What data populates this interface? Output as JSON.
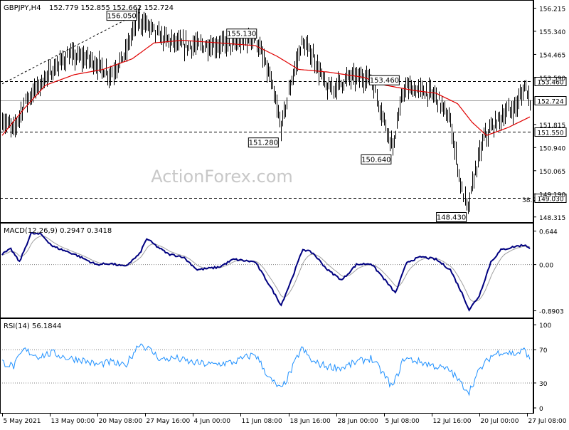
{
  "header": {
    "symbol_label": "GBPJPY,H4",
    "ohlc_label": "152.779 152.855 152.662 152.724",
    "macd_label": "MACD(12,26,9) 0.2947 0.3418",
    "rsi_label": "RSI(14) 56.1844",
    "watermark": "ActionForex.com"
  },
  "colors": {
    "price_bars": "#000000",
    "moving_average": "#e00000",
    "macd_line": "#000080",
    "macd_signal": "#a0a0a0",
    "rsi_line": "#1e90ff",
    "levels": "#000000",
    "frame": "#000000"
  },
  "chart_data": [
    {
      "type": "candlestick",
      "panel": "price",
      "title": "GBPJPY,H4",
      "x_tick_labels": [
        "5 May 2021",
        "13 May 00:00",
        "20 May 08:00",
        "27 May 16:00",
        "4 Jun 00:00",
        "11 Jun 08:00",
        "18 Jun 16:00",
        "28 Jun 00:00",
        "5 Jul 08:00",
        "12 Jul 16:00",
        "20 Jul 00:00",
        "27 Jul 08:00"
      ],
      "y_tick_labels": [
        "156.215",
        "155.340",
        "154.465",
        "153.590",
        "152.724",
        "151.815",
        "150.940",
        "150.065",
        "149.190",
        "148.315"
      ],
      "ylim": [
        148.12,
        156.47
      ],
      "anchor_points": [
        {
          "i": 0,
          "price": 152.0
        },
        {
          "i": 8,
          "price": 151.6
        },
        {
          "i": 16,
          "price": 152.7
        },
        {
          "i": 30,
          "price": 153.6
        },
        {
          "i": 45,
          "price": 154.4
        },
        {
          "i": 60,
          "price": 154.3
        },
        {
          "i": 75,
          "price": 153.7
        },
        {
          "i": 85,
          "price": 154.5
        },
        {
          "i": 93,
          "price": 155.8
        },
        {
          "i": 100,
          "price": 155.6
        },
        {
          "i": 110,
          "price": 155.1
        },
        {
          "i": 125,
          "price": 154.8
        },
        {
          "i": 145,
          "price": 154.8
        },
        {
          "i": 165,
          "price": 154.9
        },
        {
          "i": 175,
          "price": 155.1
        },
        {
          "i": 185,
          "price": 153.6
        },
        {
          "i": 193,
          "price": 151.7
        },
        {
          "i": 200,
          "price": 153.5
        },
        {
          "i": 207,
          "price": 154.9
        },
        {
          "i": 215,
          "price": 154.4
        },
        {
          "i": 225,
          "price": 153.1
        },
        {
          "i": 240,
          "price": 153.6
        },
        {
          "i": 255,
          "price": 153.6
        },
        {
          "i": 262,
          "price": 152.3
        },
        {
          "i": 270,
          "price": 151.0
        },
        {
          "i": 278,
          "price": 153.2
        },
        {
          "i": 290,
          "price": 153.1
        },
        {
          "i": 300,
          "price": 152.9
        },
        {
          "i": 310,
          "price": 151.9
        },
        {
          "i": 318,
          "price": 149.3
        },
        {
          "i": 322,
          "price": 148.6
        },
        {
          "i": 326,
          "price": 149.8
        },
        {
          "i": 333,
          "price": 151.3
        },
        {
          "i": 345,
          "price": 152.1
        },
        {
          "i": 355,
          "price": 152.5
        },
        {
          "i": 362,
          "price": 153.3
        },
        {
          "i": 365,
          "price": 152.7
        }
      ],
      "moving_average_points": [
        {
          "i": 0,
          "price": 151.4
        },
        {
          "i": 15,
          "price": 152.4
        },
        {
          "i": 30,
          "price": 153.3
        },
        {
          "i": 50,
          "price": 153.7
        },
        {
          "i": 70,
          "price": 153.9
        },
        {
          "i": 90,
          "price": 154.3
        },
        {
          "i": 105,
          "price": 154.9
        },
        {
          "i": 125,
          "price": 155.0
        },
        {
          "i": 150,
          "price": 154.9
        },
        {
          "i": 175,
          "price": 154.8
        },
        {
          "i": 190,
          "price": 154.4
        },
        {
          "i": 205,
          "price": 153.9
        },
        {
          "i": 225,
          "price": 153.8
        },
        {
          "i": 250,
          "price": 153.6
        },
        {
          "i": 265,
          "price": 153.3
        },
        {
          "i": 285,
          "price": 153.1
        },
        {
          "i": 300,
          "price": 153.0
        },
        {
          "i": 315,
          "price": 152.6
        },
        {
          "i": 325,
          "price": 151.9
        },
        {
          "i": 335,
          "price": 151.4
        },
        {
          "i": 350,
          "price": 151.7
        },
        {
          "i": 365,
          "price": 152.1
        }
      ],
      "levels": [
        {
          "price": 153.46,
          "label": "153.460",
          "style": "dashed"
        },
        {
          "price": 152.724,
          "label": "152.724",
          "style": "solid-gray"
        },
        {
          "price": 151.55,
          "label": "151.550",
          "style": "dashed"
        },
        {
          "price": 149.03,
          "label": "149.030",
          "style": "dashed"
        }
      ],
      "fib_label": "38.2",
      "annotations": [
        {
          "text": "156.050",
          "i": 95,
          "price": 156.05
        },
        {
          "text": "155.130",
          "i": 175,
          "price": 155.13
        },
        {
          "text": "151.280",
          "i": 193,
          "price": 151.28
        },
        {
          "text": "153.460",
          "i": 255,
          "price": 153.46
        },
        {
          "text": "150.640",
          "i": 270,
          "price": 150.64
        },
        {
          "text": "148.430",
          "i": 322,
          "price": 148.43
        }
      ],
      "trendline": [
        {
          "i": 0,
          "price": 153.35
        },
        {
          "i": 95,
          "price": 156.05
        }
      ]
    },
    {
      "type": "line",
      "panel": "macd",
      "title": "MACD(12,26,9) 0.2947 0.3418",
      "y_tick_labels": [
        "0.644",
        "0.00",
        "-0.8903"
      ],
      "ylim": [
        -1.02,
        0.79
      ],
      "anchor_points": [
        {
          "i": 0,
          "value": 0.2
        },
        {
          "i": 6,
          "value": 0.3
        },
        {
          "i": 12,
          "value": 0.05
        },
        {
          "i": 20,
          "value": 0.6
        },
        {
          "i": 27,
          "value": 0.58
        },
        {
          "i": 35,
          "value": 0.35
        },
        {
          "i": 50,
          "value": 0.2
        },
        {
          "i": 65,
          "value": 0.0
        },
        {
          "i": 75,
          "value": 0.02
        },
        {
          "i": 85,
          "value": -0.04
        },
        {
          "i": 95,
          "value": 0.2
        },
        {
          "i": 100,
          "value": 0.5
        },
        {
          "i": 107,
          "value": 0.35
        },
        {
          "i": 115,
          "value": 0.2
        },
        {
          "i": 125,
          "value": 0.15
        },
        {
          "i": 135,
          "value": -0.1
        },
        {
          "i": 150,
          "value": -0.05
        },
        {
          "i": 160,
          "value": 0.1
        },
        {
          "i": 175,
          "value": 0.05
        },
        {
          "i": 185,
          "value": -0.4
        },
        {
          "i": 193,
          "value": -0.78
        },
        {
          "i": 200,
          "value": -0.3
        },
        {
          "i": 208,
          "value": 0.3
        },
        {
          "i": 215,
          "value": 0.22
        },
        {
          "i": 225,
          "value": -0.1
        },
        {
          "i": 235,
          "value": -0.3
        },
        {
          "i": 245,
          "value": 0.0
        },
        {
          "i": 255,
          "value": 0.02
        },
        {
          "i": 262,
          "value": -0.2
        },
        {
          "i": 272,
          "value": -0.55
        },
        {
          "i": 280,
          "value": 0.05
        },
        {
          "i": 290,
          "value": 0.15
        },
        {
          "i": 300,
          "value": 0.1
        },
        {
          "i": 310,
          "value": -0.1
        },
        {
          "i": 318,
          "value": -0.55
        },
        {
          "i": 323,
          "value": -0.87
        },
        {
          "i": 330,
          "value": -0.6
        },
        {
          "i": 338,
          "value": 0.05
        },
        {
          "i": 345,
          "value": 0.28
        },
        {
          "i": 355,
          "value": 0.35
        },
        {
          "i": 362,
          "value": 0.38
        },
        {
          "i": 365,
          "value": 0.3
        }
      ]
    },
    {
      "type": "line",
      "panel": "rsi",
      "title": "RSI(14) 56.1844",
      "y_tick_labels": [
        "100",
        "70",
        "30",
        "0"
      ],
      "ylim": [
        -6,
        107
      ],
      "anchor_points": [
        {
          "i": 0,
          "value": 55
        },
        {
          "i": 8,
          "value": 50
        },
        {
          "i": 15,
          "value": 70
        },
        {
          "i": 25,
          "value": 62
        },
        {
          "i": 35,
          "value": 66
        },
        {
          "i": 45,
          "value": 60
        },
        {
          "i": 55,
          "value": 58
        },
        {
          "i": 65,
          "value": 52
        },
        {
          "i": 75,
          "value": 55
        },
        {
          "i": 85,
          "value": 50
        },
        {
          "i": 95,
          "value": 78
        },
        {
          "i": 102,
          "value": 70
        },
        {
          "i": 110,
          "value": 58
        },
        {
          "i": 120,
          "value": 60
        },
        {
          "i": 130,
          "value": 55
        },
        {
          "i": 145,
          "value": 52
        },
        {
          "i": 160,
          "value": 55
        },
        {
          "i": 175,
          "value": 65
        },
        {
          "i": 185,
          "value": 35
        },
        {
          "i": 193,
          "value": 22
        },
        {
          "i": 200,
          "value": 45
        },
        {
          "i": 207,
          "value": 72
        },
        {
          "i": 215,
          "value": 55
        },
        {
          "i": 225,
          "value": 50
        },
        {
          "i": 235,
          "value": 48
        },
        {
          "i": 245,
          "value": 55
        },
        {
          "i": 255,
          "value": 60
        },
        {
          "i": 262,
          "value": 45
        },
        {
          "i": 270,
          "value": 25
        },
        {
          "i": 278,
          "value": 60
        },
        {
          "i": 290,
          "value": 55
        },
        {
          "i": 300,
          "value": 50
        },
        {
          "i": 310,
          "value": 45
        },
        {
          "i": 318,
          "value": 28
        },
        {
          "i": 323,
          "value": 20
        },
        {
          "i": 330,
          "value": 45
        },
        {
          "i": 338,
          "value": 62
        },
        {
          "i": 345,
          "value": 68
        },
        {
          "i": 355,
          "value": 65
        },
        {
          "i": 362,
          "value": 70
        },
        {
          "i": 365,
          "value": 56
        }
      ],
      "levels": [
        70,
        30
      ]
    }
  ]
}
